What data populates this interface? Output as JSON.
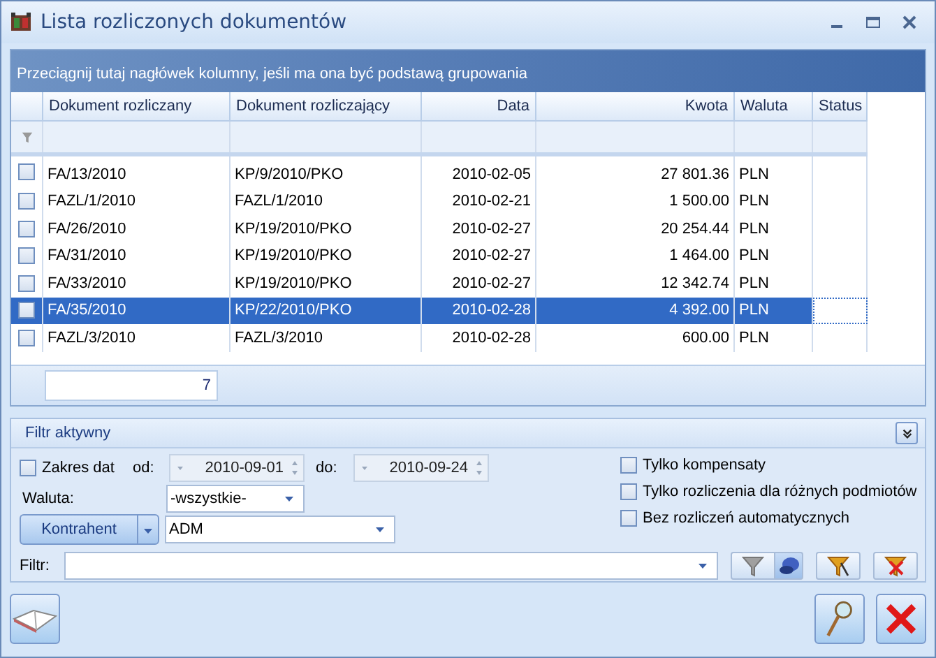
{
  "window": {
    "title": "Lista rozliczonych dokumentów"
  },
  "grid": {
    "group_hint": "Przeciągnij tutaj nagłówek kolumny, jeśli ma ona być podstawą grupowania",
    "columns": [
      "Dokument rozliczany",
      "Dokument rozliczający",
      "Data",
      "Kwota",
      "Waluta",
      "Status"
    ],
    "rows": [
      {
        "checked": false,
        "selected": false,
        "cells": [
          "FA/13/2010",
          "KP/9/2010/PKO",
          "2010-02-05",
          "27 801.36",
          "PLN"
        ]
      },
      {
        "checked": false,
        "selected": false,
        "cells": [
          "FAZL/1/2010",
          "FAZL/1/2010",
          "2010-02-21",
          "1 500.00",
          "PLN"
        ]
      },
      {
        "checked": false,
        "selected": false,
        "cells": [
          "FA/26/2010",
          "KP/19/2010/PKO",
          "2010-02-27",
          "20 254.44",
          "PLN"
        ]
      },
      {
        "checked": false,
        "selected": false,
        "cells": [
          "FA/31/2010",
          "KP/19/2010/PKO",
          "2010-02-27",
          "1 464.00",
          "PLN"
        ]
      },
      {
        "checked": false,
        "selected": false,
        "cells": [
          "FA/33/2010",
          "KP/19/2010/PKO",
          "2010-02-27",
          "12 342.74",
          "PLN"
        ]
      },
      {
        "checked": false,
        "selected": true,
        "cells": [
          "FA/35/2010",
          "KP/22/2010/PKO",
          "2010-02-28",
          "4 392.00",
          "PLN"
        ]
      },
      {
        "checked": false,
        "selected": false,
        "cells": [
          "FAZL/3/2010",
          "FAZL/3/2010",
          "2010-02-28",
          "600.00",
          "PLN"
        ]
      }
    ],
    "footer_count": "7"
  },
  "filter": {
    "title": "Filtr aktywny",
    "date_range": {
      "label": "Zakres dat",
      "checked": false,
      "from_label": "od:",
      "from": "2010-09-01",
      "to_label": "do:",
      "to": "2010-09-24"
    },
    "currency": {
      "label": "Waluta:",
      "value": "-wszystkie-"
    },
    "contractor": {
      "button": "Kontrahent",
      "value": "ADM"
    },
    "options": [
      {
        "label": "Tylko kompensaty",
        "checked": false
      },
      {
        "label": "Tylko rozliczenia dla różnych podmiotów",
        "checked": false
      },
      {
        "label": "Bez rozliczeń automatycznych",
        "checked": false
      }
    ],
    "filter_field": {
      "label": "Filtr:"
    }
  }
}
